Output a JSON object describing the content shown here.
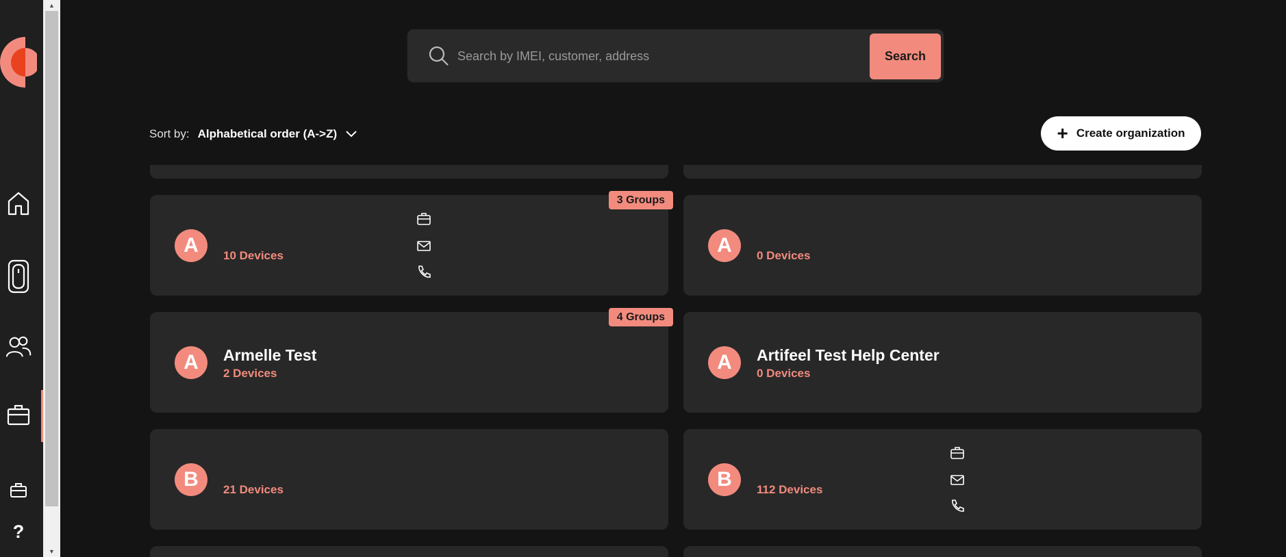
{
  "search": {
    "placeholder": "Search by IMEI, customer, address",
    "button_label": "Search"
  },
  "sort": {
    "label": "Sort by:",
    "value": "Alphabetical order (A->Z)"
  },
  "create_button": {
    "label": "Create organization"
  },
  "sidebar": {
    "items": [
      {
        "icon": "home-icon"
      },
      {
        "icon": "device-icon"
      },
      {
        "icon": "users-icon"
      },
      {
        "icon": "briefcase-icon",
        "active": true
      },
      {
        "icon": "briefcase-small-icon"
      }
    ],
    "help_label": "?"
  },
  "organizations": [
    {
      "initial": "A",
      "name": "",
      "devices": "10 Devices",
      "groups": "3 Groups",
      "contact_icons": true
    },
    {
      "initial": "A",
      "name": "",
      "devices": "0 Devices",
      "groups": "",
      "contact_icons": false
    },
    {
      "initial": "A",
      "name": "Armelle Test",
      "devices": "2 Devices",
      "groups": "4 Groups",
      "contact_icons": false
    },
    {
      "initial": "A",
      "name": "Artifeel Test Help Center",
      "devices": "0 Devices",
      "groups": "",
      "contact_icons": false
    },
    {
      "initial": "B",
      "name": "",
      "devices": "21 Devices",
      "groups": "",
      "contact_icons": false
    },
    {
      "initial": "B",
      "name": "",
      "devices": "112 Devices",
      "groups": "",
      "contact_icons": true
    }
  ],
  "colors": {
    "accent": "#f28b7e",
    "background": "#141414",
    "card": "#282828"
  }
}
